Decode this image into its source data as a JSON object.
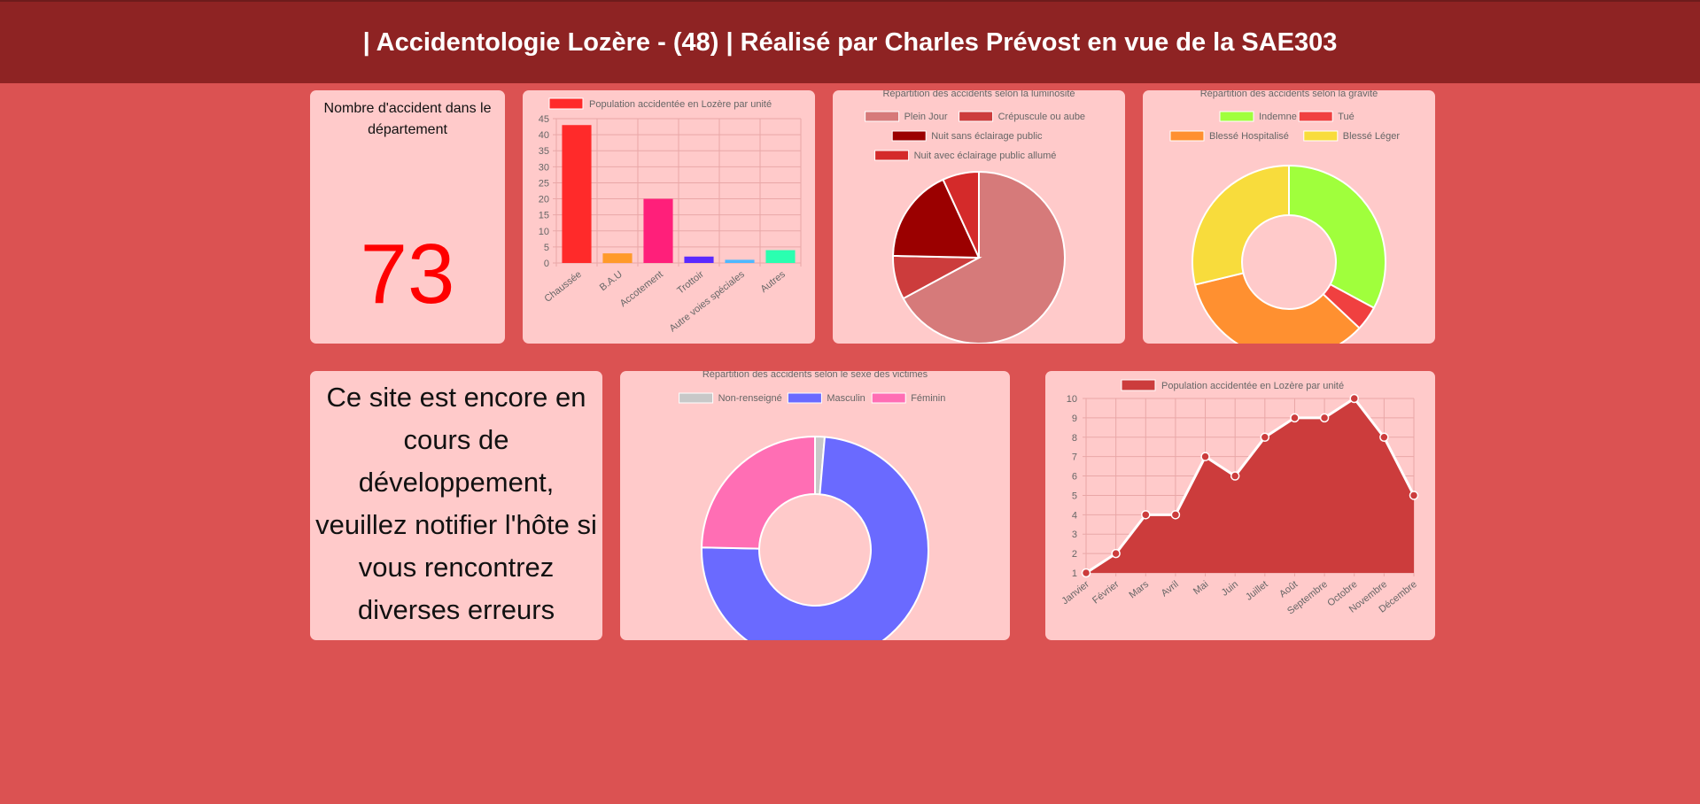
{
  "header": {
    "title": "| Accidentologie Lozère - (48) | Réalisé par Charles Prévost en vue de la SAE303"
  },
  "counter": {
    "title": "Nombre d'accident dans le département",
    "value": "73"
  },
  "notice": {
    "text": "Ce site est encore en cours de développement, veuillez notifier l'hôte si vous rencontrez diverses erreurs"
  },
  "chart_data": [
    {
      "id": "surface",
      "type": "bar",
      "title": "",
      "legend": [
        {
          "label": "Population accidentée en Lozère par unité",
          "color": "#ff2a2a"
        }
      ],
      "categories": [
        "Chaussée",
        "B.A.U",
        "Accotement",
        "Trottoir",
        "Autre voies spéciales",
        "Autres"
      ],
      "values": [
        43,
        3,
        20,
        2,
        1,
        4
      ],
      "colors": [
        "#ff2a2a",
        "#ff9a2a",
        "#ff1f7a",
        "#5a2aff",
        "#4db8ff",
        "#2affb0"
      ],
      "ylim": [
        0,
        45
      ],
      "yticks": [
        0,
        5,
        10,
        15,
        20,
        25,
        30,
        35,
        40,
        45
      ],
      "grid": true
    },
    {
      "id": "luminosite",
      "type": "pie",
      "title": "Répartition des accidents selon la luminosité",
      "labels": [
        "Plein Jour",
        "Crépuscule ou aube",
        "Nuit sans éclairage public",
        "Nuit avec éclairage public allumé"
      ],
      "values": [
        49,
        6,
        13,
        5
      ],
      "colors": [
        "#d67a7a",
        "#cc3c3c",
        "#9b0000",
        "#d42a2a"
      ],
      "legend_position": "top"
    },
    {
      "id": "gravite",
      "type": "doughnut",
      "title": "Répartition des accidents selon la gravité",
      "labels": [
        "Indemne",
        "Tué",
        "Blessé Hospitalisé",
        "Blessé Léger"
      ],
      "values": [
        24,
        3,
        25,
        21
      ],
      "colors": [
        "#a0ff3c",
        "#f04040",
        "#ff9030",
        "#f8dc3c"
      ],
      "legend_position": "top"
    },
    {
      "id": "sexe",
      "type": "doughnut",
      "title": "Répartition des accidents selon le sexe des victimes",
      "labels": [
        "Non-renseigné",
        "Masculin",
        "Féminin"
      ],
      "values": [
        1,
        54,
        18
      ],
      "colors": [
        "#c8c8c8",
        "#6a6aff",
        "#ff6eb4"
      ],
      "legend_position": "top"
    },
    {
      "id": "mois",
      "type": "area",
      "title": "",
      "legend": [
        {
          "label": "Population accidentée en Lozère par unité",
          "color": "#cc3c3c"
        }
      ],
      "categories": [
        "Janvier",
        "Février",
        "Mars",
        "Avril",
        "Mai",
        "Juin",
        "Juillet",
        "Août",
        "Septembre",
        "Octobre",
        "Novembre",
        "Décembre"
      ],
      "values": [
        1,
        2,
        4,
        4,
        7,
        6,
        8,
        9,
        9,
        10,
        8,
        5
      ],
      "ylim": [
        1,
        10
      ],
      "yticks": [
        1,
        2,
        3,
        4,
        5,
        6,
        7,
        8,
        9,
        10
      ],
      "color": "#cc3c3c",
      "grid": true
    }
  ]
}
